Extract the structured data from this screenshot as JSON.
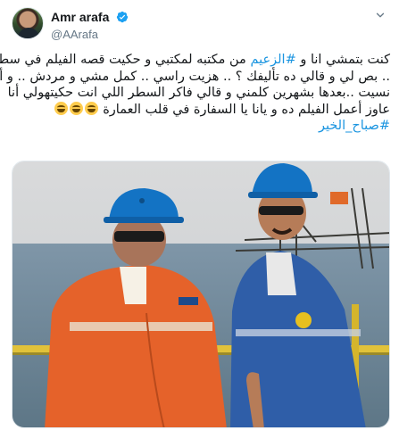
{
  "author": {
    "display_name": "Amr arafa",
    "handle": "@AArafa",
    "verified": true,
    "avatar_icon": "profile-avatar"
  },
  "tweet": {
    "lines": [
      {
        "before": "كنت بتمشي انا و ",
        "hashtag": "#الزعيم",
        "after": " من مكتبه لمكتبي و حكيت قصه الفيلم في سطر"
      },
      {
        "text": ".. بص لي و قالي ده تأليفك ؟ ..  هزيت راسي .. كمل مشي و مردش .. و أنا"
      },
      {
        "text": "نسيت ..بعدها بشهرين كلمني و قالي فاكر السطر اللي انت حكيتهولي أنا"
      },
      {
        "text": "عاوز أعمل الفيلم ده و يانا يا السفارة في قلب العمارة"
      },
      {
        "hashtag": "#صباح_الخير"
      }
    ],
    "emoji": [
      "joy-emoji",
      "joy-emoji",
      "joy-emoji"
    ]
  },
  "colors": {
    "text": "#14171a",
    "secondary": "#657786",
    "link": "#1b95e0",
    "verified": "#1da1f2"
  },
  "icons": {
    "verified": "verified-badge-icon",
    "more": "chevron-down-icon"
  },
  "media": {
    "kind": "photo",
    "subject": "two-men-hard-hats-offshore-platform"
  }
}
